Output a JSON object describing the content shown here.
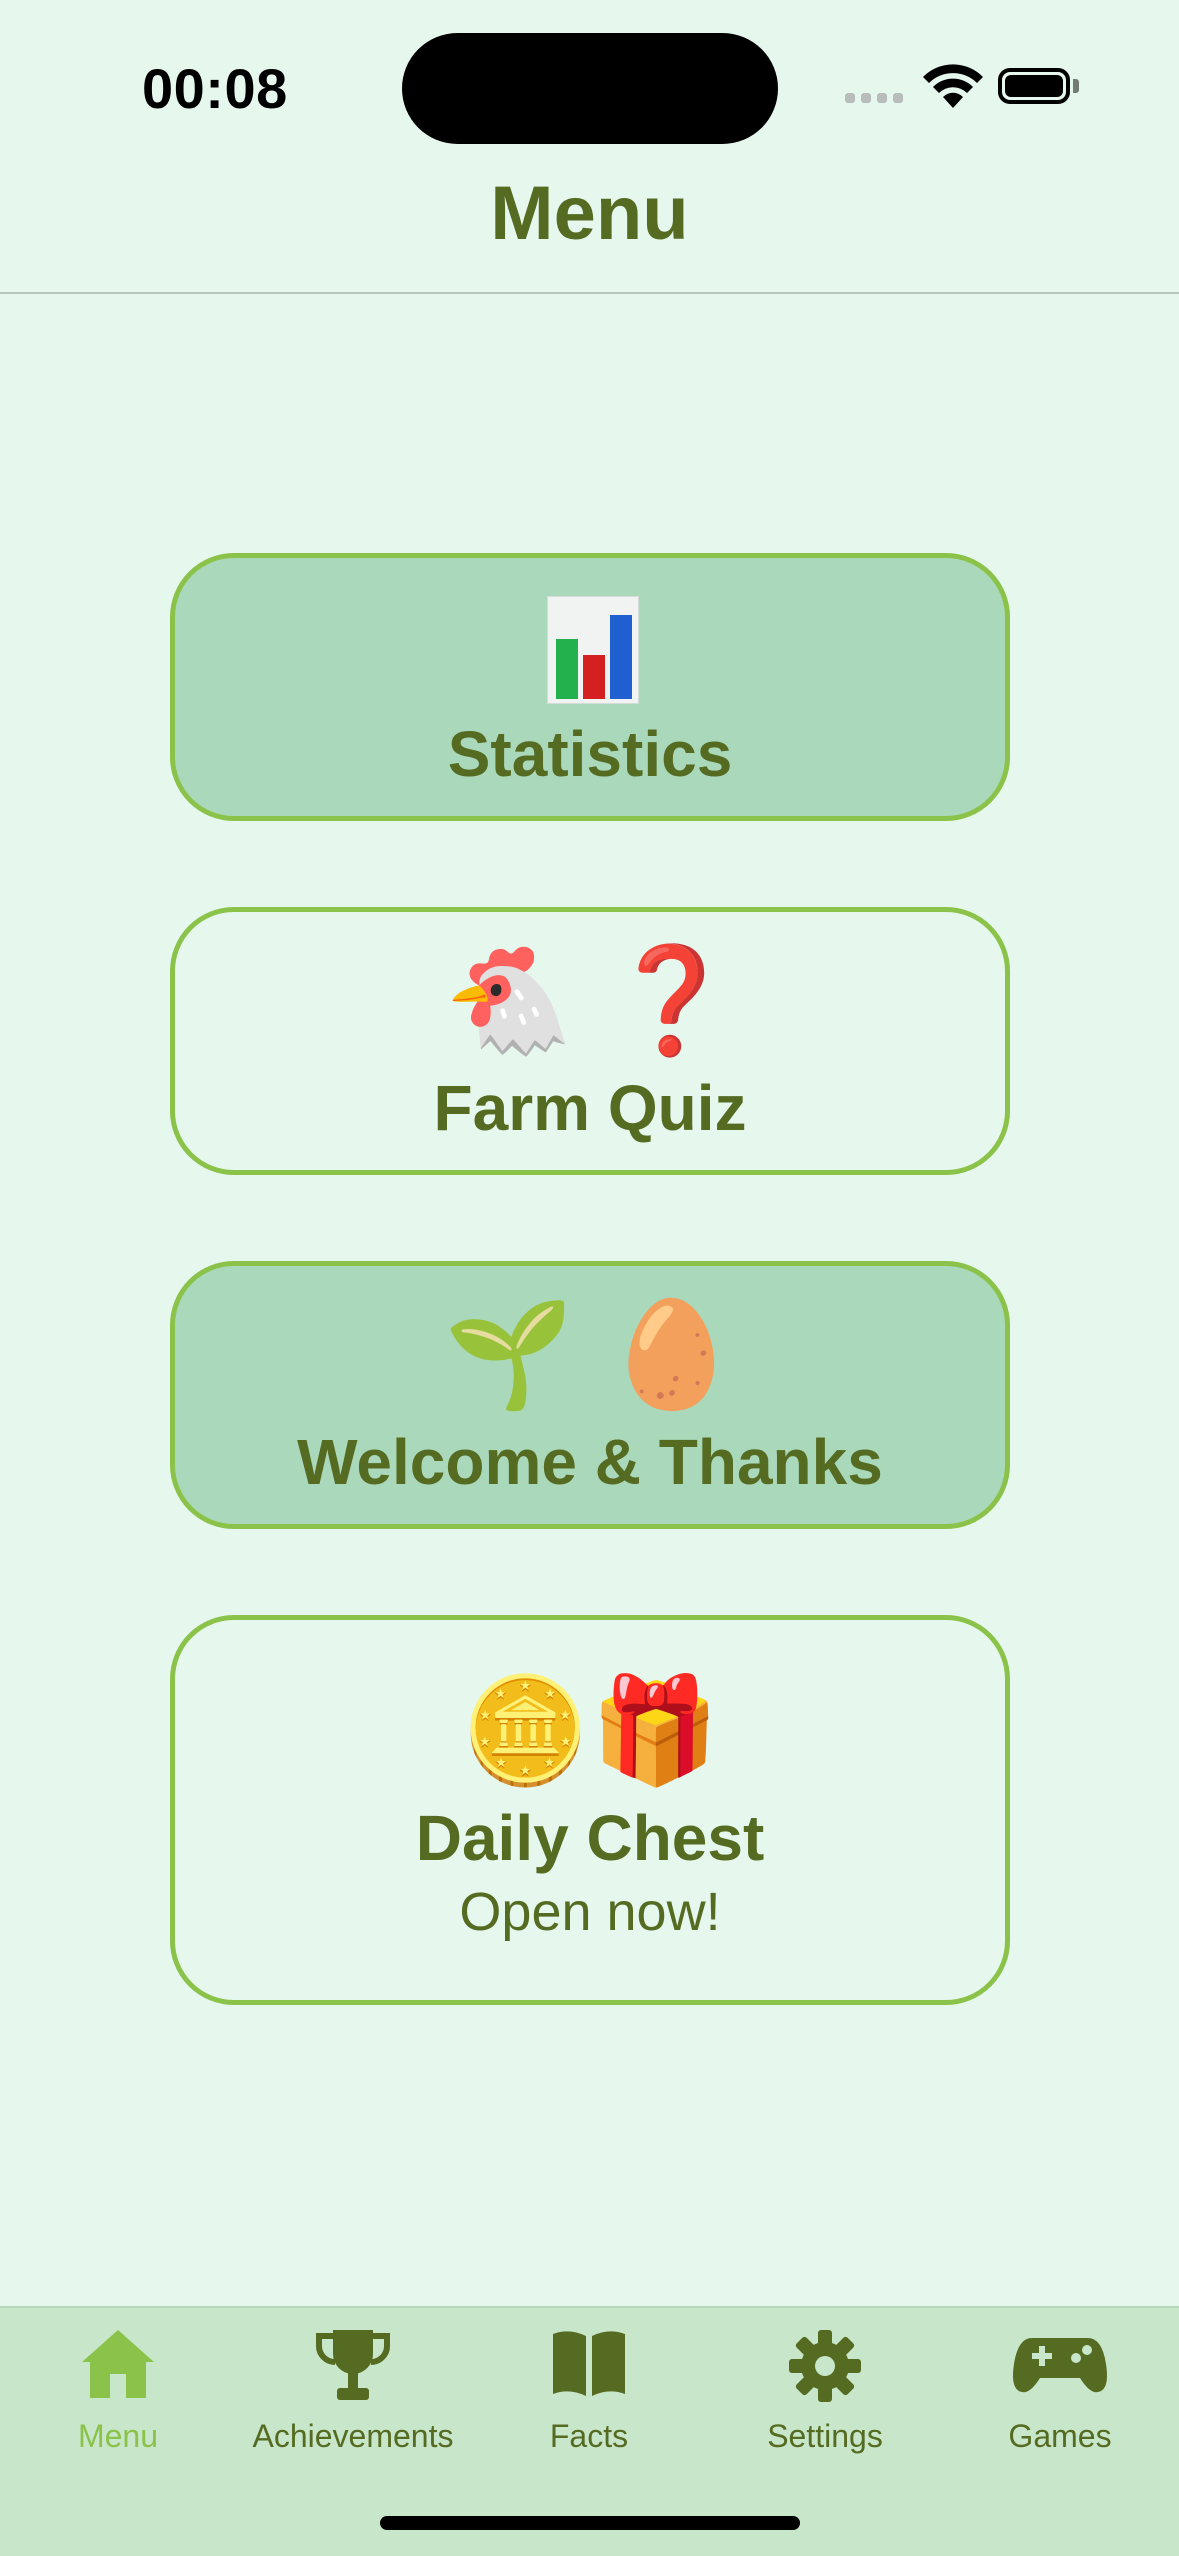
{
  "status_bar": {
    "time": "00:08",
    "icons": [
      "cellular-signal-icon",
      "wifi-icon",
      "battery-icon"
    ]
  },
  "nav": {
    "title": "Menu"
  },
  "cards": [
    {
      "id": "statistics",
      "emoji": "",
      "icon": "bar-chart-icon",
      "label": "Statistics",
      "style": "filled"
    },
    {
      "id": "farm-quiz",
      "emoji": "🐔 ❓",
      "label": "Farm Quiz",
      "style": "outlined"
    },
    {
      "id": "welcome",
      "emoji": "🌱 🥚",
      "label": "Welcome & Thanks",
      "style": "filled"
    },
    {
      "id": "daily-chest",
      "emoji": "🪙🎁",
      "label": "Daily Chest",
      "sub": "Open now!",
      "style": "outlined"
    }
  ],
  "tabs": [
    {
      "label": "Menu",
      "icon": "home-icon",
      "active": true
    },
    {
      "label": "Achievements",
      "icon": "trophy-icon",
      "active": false
    },
    {
      "label": "Facts",
      "icon": "book-icon",
      "active": false
    },
    {
      "label": "Settings",
      "icon": "gear-icon",
      "active": false
    },
    {
      "label": "Games",
      "icon": "gamepad-icon",
      "active": false
    }
  ],
  "colors": {
    "background": "#e6f7ee",
    "accent": "#8bc34a",
    "text": "#556b22",
    "card_fill": "#aad8bb",
    "tab_bar": "#c8e6c9"
  }
}
